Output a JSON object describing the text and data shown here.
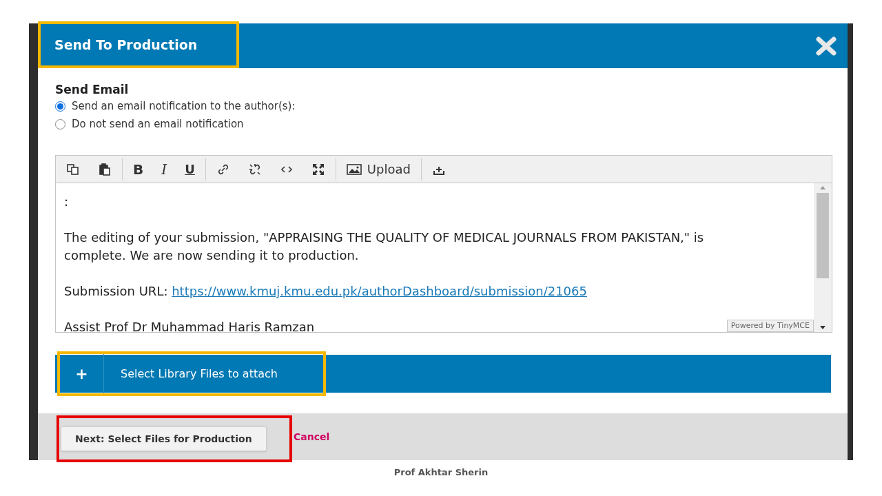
{
  "dialog": {
    "title": "Send To Production",
    "title_highlighted": true
  },
  "send_email": {
    "heading": "Send Email",
    "options": [
      {
        "label": "Send an email notification to the author(s):",
        "selected": true
      },
      {
        "label": "Do not send an email notification",
        "selected": false
      }
    ]
  },
  "editor": {
    "toolbar": [
      {
        "kind": "copy"
      },
      {
        "kind": "paste"
      },
      {
        "kind": "sep"
      },
      {
        "kind": "bold",
        "label": "B"
      },
      {
        "kind": "italic",
        "label": "I"
      },
      {
        "kind": "underline",
        "label": "U"
      },
      {
        "kind": "sep"
      },
      {
        "kind": "link"
      },
      {
        "kind": "unlink"
      },
      {
        "kind": "code"
      },
      {
        "kind": "fullscreen"
      },
      {
        "kind": "sep"
      },
      {
        "kind": "image",
        "label": "Upload"
      },
      {
        "kind": "sep"
      },
      {
        "kind": "upload"
      }
    ],
    "content": [
      {
        "kind": "text",
        "text": ":"
      },
      {
        "kind": "blank"
      },
      {
        "kind": "text",
        "text": "The editing of your submission, \"APPRAISING THE QUALITY OF MEDICAL JOURNALS FROM PAKISTAN,\" is complete. We are now sending it to production."
      },
      {
        "kind": "blank"
      },
      {
        "kind": "link",
        "text": "Submission URL: ",
        "link": "https://www.kmuj.kmu.edu.pk/authorDashboard/submission/21065"
      },
      {
        "kind": "blank"
      },
      {
        "kind": "text",
        "text": "Assist Prof Dr Muhammad Haris Ramzan"
      }
    ],
    "branding": "Powered by TinyMCE"
  },
  "attach": {
    "icon": "+",
    "label": "Select Library Files to attach",
    "highlighted": true
  },
  "footer": {
    "next_button": "Next: Select Files for Production",
    "cancel": "Cancel",
    "next_button_flagged": true
  },
  "caption": "Prof Akhtar Sherin"
}
